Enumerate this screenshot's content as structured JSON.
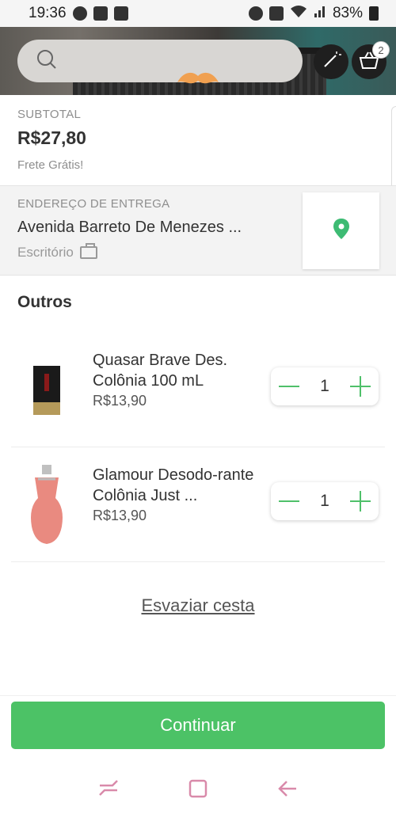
{
  "status_bar": {
    "time": "19:36",
    "battery": "83%"
  },
  "header": {
    "search_placeholder": "",
    "cart_count": "2",
    "icons": [
      "search-icon",
      "magic-wand-icon",
      "basket-icon",
      "mustache-logo"
    ]
  },
  "summary": {
    "subtotal_label": "SUBTOTAL",
    "subtotal_value": "R$27,80",
    "shipping": "Frete Grátis!"
  },
  "address": {
    "label": "ENDEREÇO DE ENTREGA",
    "street": "Avenida Barreto De Menezes ...",
    "type": "Escritório"
  },
  "section": {
    "title": "Outros"
  },
  "items": [
    {
      "name": "Quasar Brave Des. Colônia 100 mL",
      "price": "R$13,90",
      "qty": "1"
    },
    {
      "name": "Glamour Desodo-rante Colônia Just ...",
      "price": "R$13,90",
      "qty": "1"
    }
  ],
  "actions": {
    "clear": "Esvaziar cesta",
    "continue": "Continuar"
  },
  "colors": {
    "accent_green": "#4cc266",
    "map_pin": "#3dbb73",
    "nav_pink": "#d98aaa"
  }
}
